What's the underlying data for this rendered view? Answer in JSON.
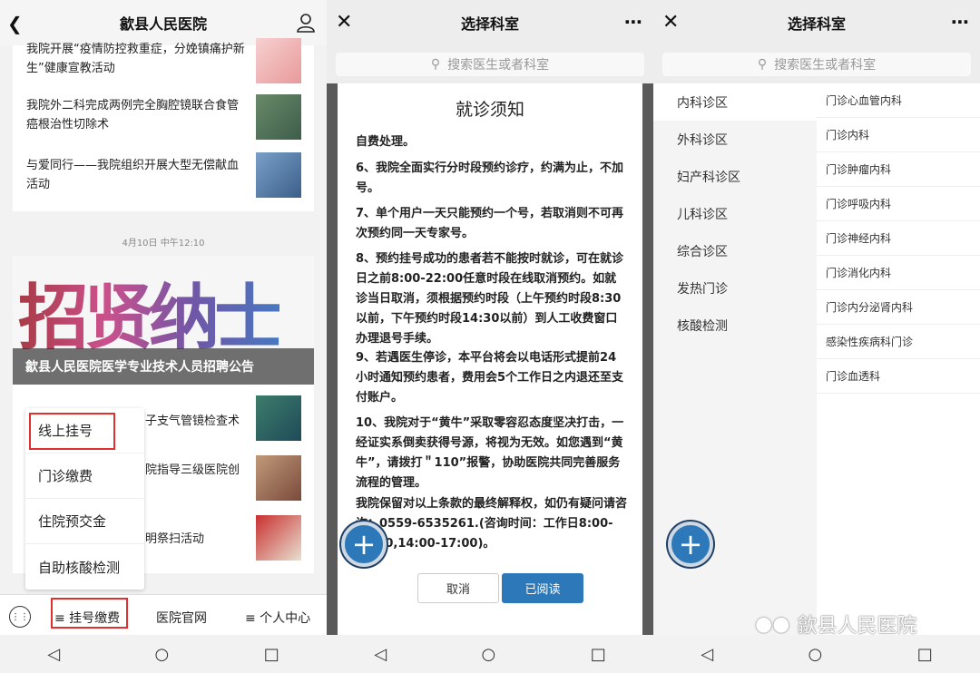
{
  "panel1": {
    "title": "歙县人民医院",
    "news_top": "我院开展“疫情防控救重症，分娩镇痛护新生”健康宣教活动",
    "news1": "我院外二科完成两例完全胸腔镜联合食管癌根治性切除术",
    "news2": "与爱同行——我院组织开展大型无偿献血活动",
    "timestamp": "4月10日 中午12:10",
    "banner_art": "招贤纳士",
    "banner_caption": "歙县人民医院医学专业技术人员招聘公告",
    "news3_partial": "子支气管镜检查术",
    "news4_partial": "院指导三级医院创",
    "news5_partial": "明祭扫活动",
    "menu": [
      "线上挂号",
      "门诊缴费",
      "住院预交金",
      "自助核酸检测"
    ],
    "bottom": {
      "tab1": "≡ 挂号缴费",
      "tab2": "医院官网",
      "tab3": "≡ 个人中心"
    }
  },
  "panel2": {
    "title": "选择科室",
    "search_placeholder": "搜索医生或者科室",
    "dialog_title": "就诊须知",
    "items": [
      "自费处理。",
      "6、我院全面实行分时段预约诊疗，约满为止，不加号。",
      "7、单个用户一天只能预约一个号，若取消则不可再次预约同一天专家号。",
      "8、预约挂号成功的患者若不能按时就诊，可在就诊日之前8:00-22:00任意时段在线取消预约。如就诊当日取消，须根据预约时段（上午预约时段8:30以前，下午预约时段14:30以前）到人工收费窗口办理退号手续。",
      "9、若遇医生停诊，本平台将会以电话形式提前24小时通知预约患者，费用会5个工作日之内退还至支付账户。",
      "10、我院对于“黄牛”采取零容忍态度坚决打击，一经证实系倒卖获得号源，将视为无效。如您遇到“黄牛”，请拨打＂110”报警，协助医院共同完善服务流程的管理。",
      "我院保留对以上条款的最终解释权，如仍有疑问请咨询：0559-6535261.(咨询时间：工作日8:00-11:30,14:00-17:00)。"
    ],
    "cancel": "取消",
    "confirm": "已阅读"
  },
  "panel3": {
    "title": "选择科室",
    "search_placeholder": "搜索医生或者科室",
    "left": [
      "内科诊区",
      "外科诊区",
      "妇产科诊区",
      "儿科诊区",
      "综合诊区",
      "发热门诊",
      "核酸检测"
    ],
    "right": [
      "门诊心血管内科",
      "门诊内科",
      "门诊肿瘤内科",
      "门诊呼吸内科",
      "门诊神经内科",
      "门诊消化内科",
      "门诊内分泌肾内科",
      "感染性疾病科门诊",
      "门诊血透科"
    ]
  },
  "watermark": "歙县人民医院",
  "colors": {
    "accent": "#2d78b8",
    "highlight": "#e03030"
  }
}
